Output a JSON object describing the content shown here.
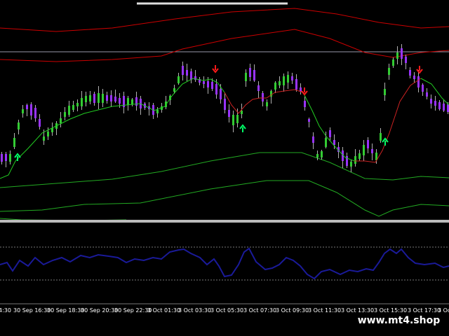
{
  "window": {
    "background": "#000000"
  },
  "colors": {
    "bull_candle": "#33cc33",
    "bear_candle": "#9933ff",
    "wick": "#b0b0b0",
    "upper_bands": "#cc0000",
    "lower_bands": "#22aa22",
    "fast_line_up": "#22cc22",
    "fast_line_down": "#cc2222",
    "arrow_up": "#00ff66",
    "arrow_down": "#ff1a1a",
    "oscillator": "#1a1a99",
    "oscillator_levels": "#777777",
    "separator": "#bbbbbb",
    "horizontal_level": "#9999aa",
    "axis_text": "#ffffff"
  },
  "time_axis": {
    "labels": [
      "4:30",
      "30 Sep 16:30",
      "30 Sep 18:30",
      "30 Sep 20:30",
      "30 Sep 22:30",
      "3 Oct 01:30",
      "3 Oct 03:30",
      "3 Oct 05:30",
      "3 Oct 07:30",
      "3 Oct 09:30",
      "3 Oct 11:30",
      "3 Oct 13:30",
      "3 Oct 15:30",
      "3 Oct 17:30",
      "3 Oct"
    ]
  },
  "watermark": "www.mt4.shop"
}
